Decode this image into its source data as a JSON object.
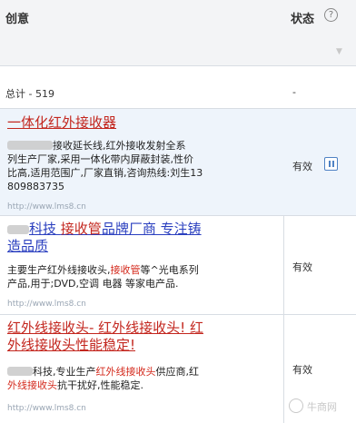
{
  "header": {
    "creative_label": "创意",
    "status_label": "状态",
    "help_icon": "question-circle-icon",
    "sort_icon": "sort-arrow-icon"
  },
  "total": {
    "label": "总计 - 519",
    "status": "-"
  },
  "ads": [
    {
      "title": "一体化红外接收器",
      "desc_lines": [
        "接收延长线,红外接收发射全系",
        "列生产厂家,采用一体化带内屏蔽封装,性价",
        "比高,适用范围广,厂家直销,咨询热线:刘生13",
        "809883735"
      ],
      "url": "http://www.lms8.cn",
      "status": "有效",
      "action_icon": "pause-icon"
    },
    {
      "title_prefix": "科技",
      "title_kw": "接收管",
      "title_suffix": "品牌厂商 专注铸",
      "title_line2": "造品质",
      "desc_line1_a": "主要生产红外线接收头,",
      "desc_line1_kw": "接收管",
      "desc_line1_b": "等^光电系列",
      "desc_line2": "产品,用于;DVD,空调 电器 等家电产品.",
      "url": "http://www.lms8.cn",
      "status": "有效"
    },
    {
      "title_line1": "红外线接收头- 红外线接收头! 红",
      "title_line2": "外线接收头性能稳定!",
      "desc_line1_a": "科技,专业生产",
      "desc_line1_kw": "红外线接收头",
      "desc_line1_b": "供应商,红",
      "desc_line2_kw": "外线接收头",
      "desc_line2_b": "抗干扰好,性能稳定.",
      "url": "http://www.lms8.cn",
      "status": "有效"
    }
  ],
  "watermark": {
    "text": "牛商网"
  }
}
